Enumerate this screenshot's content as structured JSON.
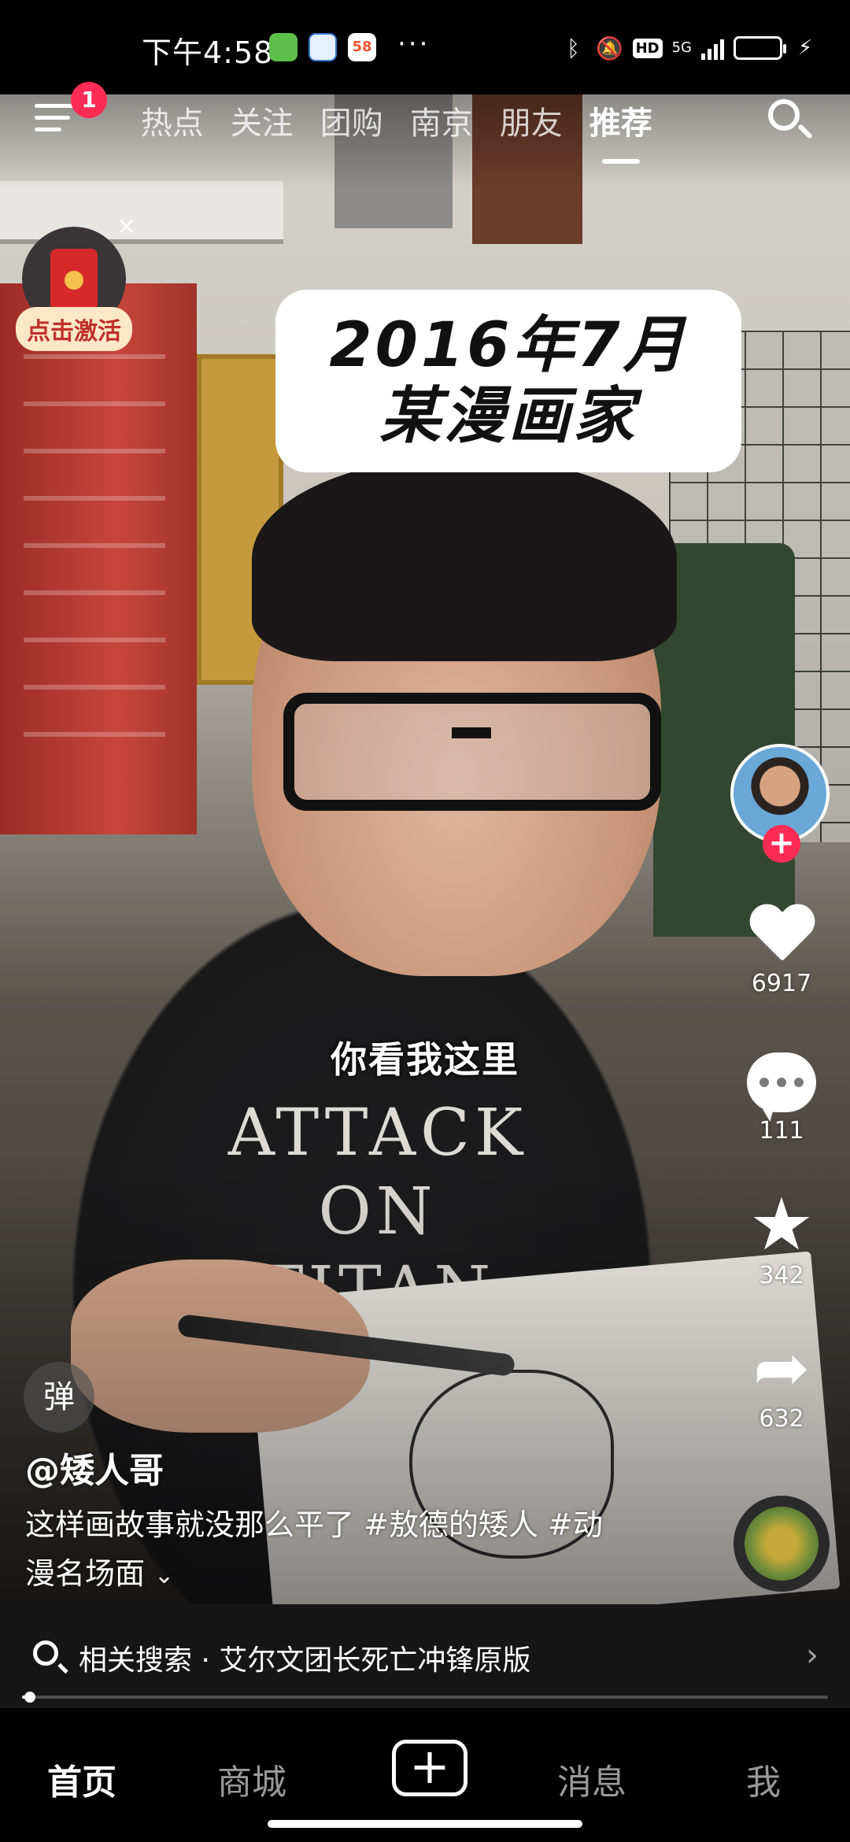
{
  "status_bar": {
    "time": "下午4:58",
    "app_icons": [
      "wechat-green-icon",
      "baidu-netdisk-icon",
      "58-app-icon"
    ],
    "more": "···",
    "network": "5G",
    "hd": "HD",
    "battery": "57",
    "battery_level": 0.57
  },
  "top_nav": {
    "notification_count": "1",
    "tabs": [
      {
        "label": "热点"
      },
      {
        "label": "关注"
      },
      {
        "label": "团购"
      },
      {
        "label": "南京"
      },
      {
        "label": "朋友"
      },
      {
        "label": "推荐"
      }
    ],
    "active_tab": "推荐"
  },
  "red_packet": {
    "label": "点击激活",
    "close": "×"
  },
  "video": {
    "title_line1": "2016年7月",
    "title_line2": "某漫画家",
    "subtitle": "你看我这里",
    "shirt_print": "ATTACK ON TITAN"
  },
  "actions": {
    "likes": "6917",
    "comments": "111",
    "favorites": "342",
    "shares": "632",
    "follow": "+"
  },
  "info": {
    "danmaku": "弹",
    "author": "@矮人哥",
    "description_line1": "这样画故事就没那么平了 #敖德的矮人 #动",
    "description_line2": "漫名场面",
    "expand": "⌄"
  },
  "related_search": {
    "text": "相关搜索 · 艾尔文团长死亡冲锋原版",
    "chevron": "›"
  },
  "playback": {
    "progress": 0.01
  },
  "bottom_tabs": {
    "home": "首页",
    "mall": "商城",
    "create": "+",
    "messages": "消息",
    "me": "我"
  },
  "colors": {
    "accent": "#fe2c55",
    "battery_fill": "#7ed957",
    "red_packet_label_bg": "#fce8c6"
  }
}
